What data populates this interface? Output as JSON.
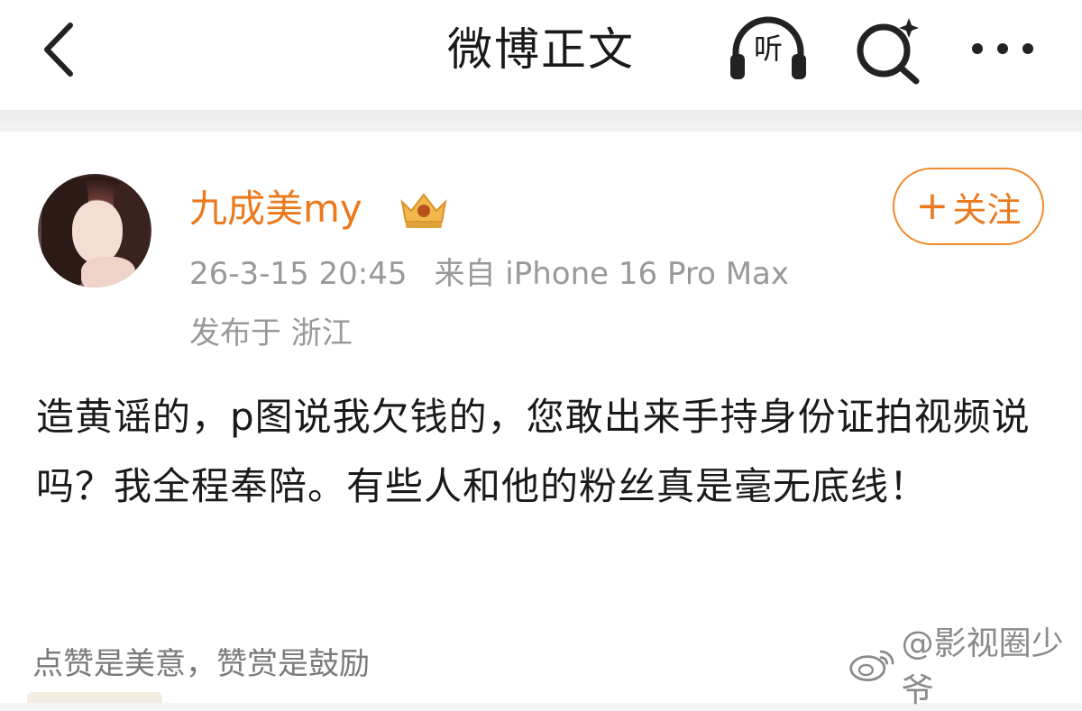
{
  "header": {
    "title": "微博正文",
    "listen_label": "听"
  },
  "post": {
    "author": {
      "name": "九成美my"
    },
    "time": "26-3-15 20:45",
    "source": "来自 iPhone 16 Pro Max",
    "location": "发布于 浙江",
    "follow_label": "关注",
    "follow_plus": "+",
    "body": "造黄谣的，p图说我欠钱的，您敢出来手持身份证拍视频说吗？我全程奉陪。有些人和他的粉丝真是毫无底线！",
    "reward_text": "点赞是美意，赞赏是鼓励"
  },
  "watermark": {
    "text": "@影视圈少爷"
  },
  "icons": {
    "back": "chevron-left-icon",
    "listen": "headphones-icon",
    "search": "search-sparkle-icon",
    "more": "more-dots-icon",
    "vip": "crown-badge-icon",
    "watermark": "weibo-logo-icon"
  },
  "colors": {
    "accent_orange": "#eb7a1e",
    "meta_gray": "#999999",
    "text_dark": "#1a1a1a"
  }
}
